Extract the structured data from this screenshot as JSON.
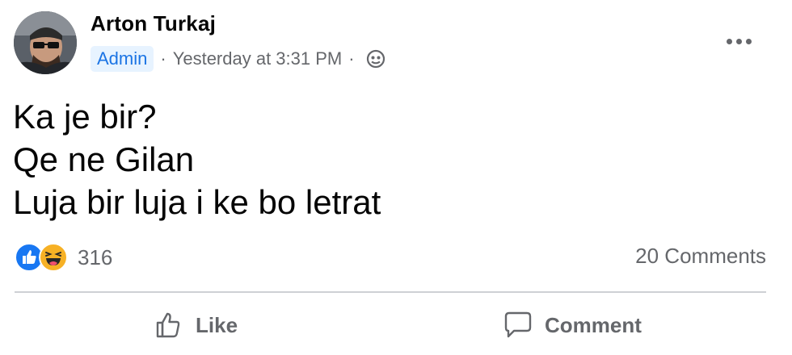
{
  "post": {
    "author": "Arton Turkaj",
    "role_badge": "Admin",
    "separator_1": "·",
    "timestamp": "Yesterday at 3:31 PM",
    "separator_2": "·",
    "audience_icon": "globe-icon",
    "more_icon": "more-options-icon",
    "lines": [
      "Ka je bir?",
      "Qe ne Gilan",
      "Luja bir luja i ke bo letrat"
    ]
  },
  "reactions": {
    "icons": [
      "like-reaction-icon",
      "haha-reaction-icon"
    ],
    "count": "316"
  },
  "comments_count": "20 Comments",
  "actions": {
    "like_label": "Like",
    "comment_label": "Comment"
  },
  "colors": {
    "secondary_text": "#65676b",
    "badge_bg": "#e7f3ff",
    "badge_text": "#1b74e4",
    "like_blue": "#1877f2",
    "haha_yellow": "#f7b125",
    "divider": "#ced0d4"
  }
}
